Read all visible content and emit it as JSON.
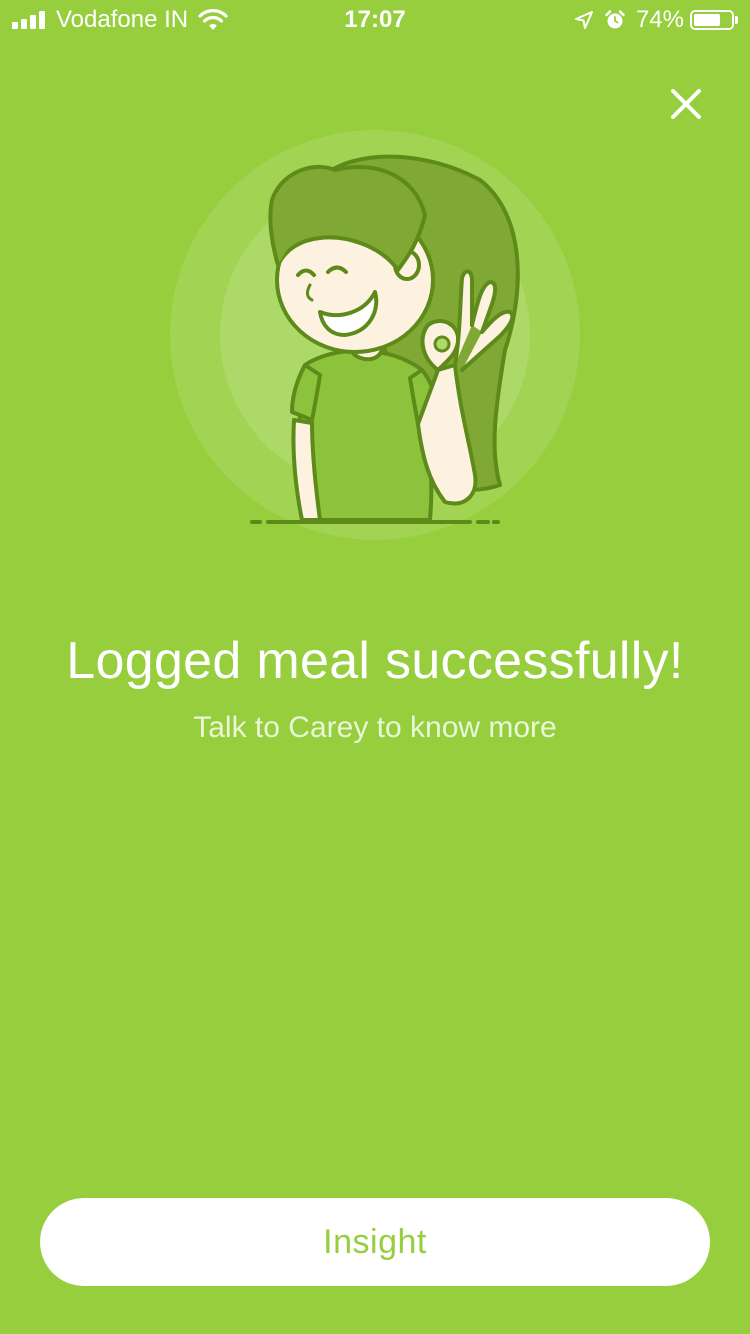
{
  "status_bar": {
    "carrier": "Vodafone IN",
    "time": "17:07",
    "battery_percent_label": "74%",
    "battery_level": 0.74,
    "icons": [
      "signal-icon",
      "wifi-icon",
      "location-arrow-icon",
      "alarm-icon",
      "battery-icon"
    ]
  },
  "header": {
    "close_icon": "close-icon"
  },
  "main": {
    "illustration": "woman-ok-gesture-illustration",
    "title": "Logged meal successfully!",
    "subtitle": "Talk to Carey to know more"
  },
  "footer": {
    "insight_label": "Insight"
  },
  "colors": {
    "background": "#96CE3D",
    "accent": "#96CE3D",
    "illustration_dark": "#5E8A1A",
    "button_bg": "#FFFFFF"
  }
}
